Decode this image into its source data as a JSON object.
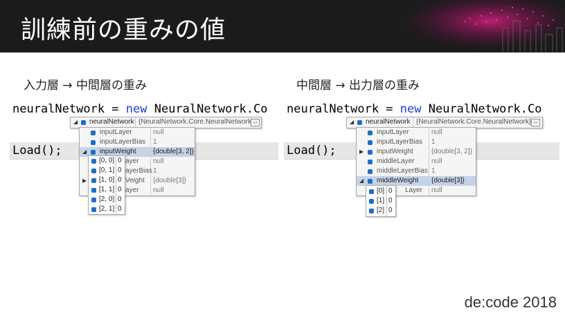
{
  "slide": {
    "title": "訓練前の重みの値",
    "footer": "de:code 2018"
  },
  "left": {
    "label": "入力層 → 中間層の重み",
    "code_var": "neuralNetwork",
    "code_eq": " = ",
    "code_kw": "new",
    "code_type": " NeuralNetwork.Co",
    "load_call": "Load();",
    "tooltip": {
      "root_name": "neuralNetwork",
      "root_value": "{NeuralNetwork.Core.NeuralNetwork}",
      "rows": [
        {
          "name": "inputLayer",
          "value": "null"
        },
        {
          "name": "inputLayerBias",
          "value": "1"
        },
        {
          "name": "inputWeight",
          "value": "{double[3, 2]}"
        },
        {
          "name": "middleLayer",
          "value": "null"
        },
        {
          "name": "middleLayerBias",
          "value": "1"
        },
        {
          "name": "middleWeight",
          "value": "{double[3]}"
        },
        {
          "name": "outputLayer",
          "value": "null"
        }
      ],
      "elements": [
        {
          "index": "[0, 0]",
          "value": "0"
        },
        {
          "index": "[0, 1]",
          "value": "0"
        },
        {
          "index": "[1, 0]",
          "value": "0"
        },
        {
          "index": "[1, 1]",
          "value": "0"
        },
        {
          "index": "[2, 0]",
          "value": "0"
        },
        {
          "index": "[2, 1]",
          "value": "0"
        }
      ]
    }
  },
  "right": {
    "label": "中間層 → 出力層の重み",
    "code_var": "neuralNetwork",
    "code_eq": " = ",
    "code_kw": "new",
    "code_type": " NeuralNetwork.Co",
    "load_call": "Load();",
    "tooltip": {
      "root_name": "neuralNetwork",
      "root_value": "{NeuralNetwork.Core.NeuralNetwork}",
      "rows": [
        {
          "name": "inputLayer",
          "value": "null"
        },
        {
          "name": "inputLayerBias",
          "value": "1"
        },
        {
          "name": "inputWeight",
          "value": "{double[3, 2]}"
        },
        {
          "name": "middleLayer",
          "value": "null"
        },
        {
          "name": "middleLayerBias",
          "value": "1"
        },
        {
          "name": "middleWeight",
          "value": "{double[3]}"
        },
        {
          "name": "outputLayer",
          "value": "null"
        }
      ],
      "elements": [
        {
          "index": "[0]",
          "value": "0"
        },
        {
          "index": "[1]",
          "value": "0"
        },
        {
          "index": "[2]",
          "value": "0"
        }
      ]
    }
  },
  "colors": {
    "header_bg": "#1b1b1b",
    "keyword": "#1b3fd6",
    "selected_row": "#c5d3e6",
    "accent_magenta": "#d0207a"
  }
}
